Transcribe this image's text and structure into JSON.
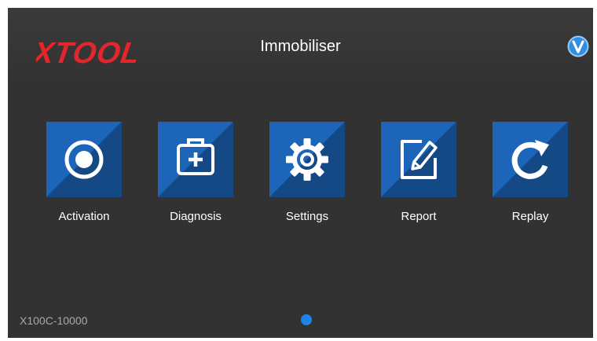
{
  "header": {
    "brand": "XTOOL",
    "title": "Immobiliser"
  },
  "tiles": [
    {
      "label": "Activation",
      "icon": "activation-target-icon"
    },
    {
      "label": "Diagnosis",
      "icon": "diagnosis-case-icon"
    },
    {
      "label": "Settings",
      "icon": "settings-gear-icon"
    },
    {
      "label": "Report",
      "icon": "report-edit-icon"
    },
    {
      "label": "Replay",
      "icon": "replay-refresh-icon"
    }
  ],
  "footer": {
    "serial": "X100C-10000",
    "page_count": 1,
    "current_page": 1
  },
  "colors": {
    "background": "#323232",
    "tile_blue": "#1c65b8",
    "brand_red": "#e3262c",
    "dot_blue": "#1d83e6",
    "badge_blue": "#2f8fe0"
  }
}
